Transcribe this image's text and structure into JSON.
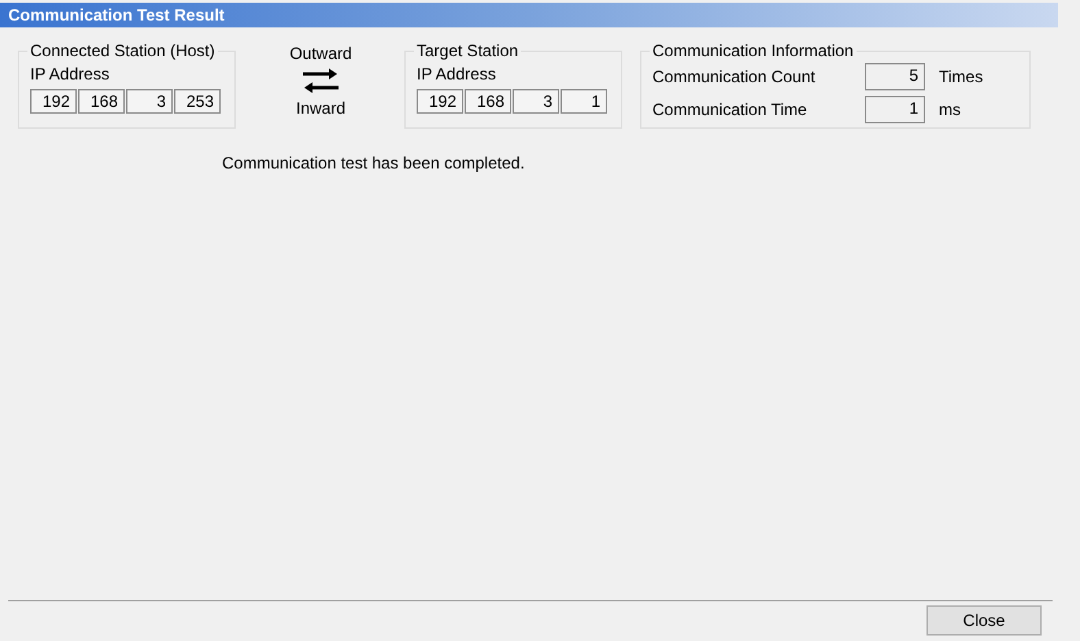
{
  "window": {
    "title": "Communication Test Result"
  },
  "host": {
    "legend": "Connected Station (Host)",
    "label": "IP Address",
    "octets": [
      "192",
      "168",
      "3",
      "253"
    ]
  },
  "direction": {
    "outward": "Outward",
    "inward": "Inward"
  },
  "target": {
    "legend": "Target Station",
    "label": "IP Address",
    "octets": [
      "192",
      "168",
      "3",
      "1"
    ]
  },
  "info": {
    "legend": "Communication Information",
    "rows": [
      {
        "label": "Communication Count",
        "value": "5",
        "unit": "Times"
      },
      {
        "label": "Communication Time",
        "value": "1",
        "unit": "ms"
      }
    ]
  },
  "message": "Communication test has been completed.",
  "buttons": [
    "Close"
  ]
}
